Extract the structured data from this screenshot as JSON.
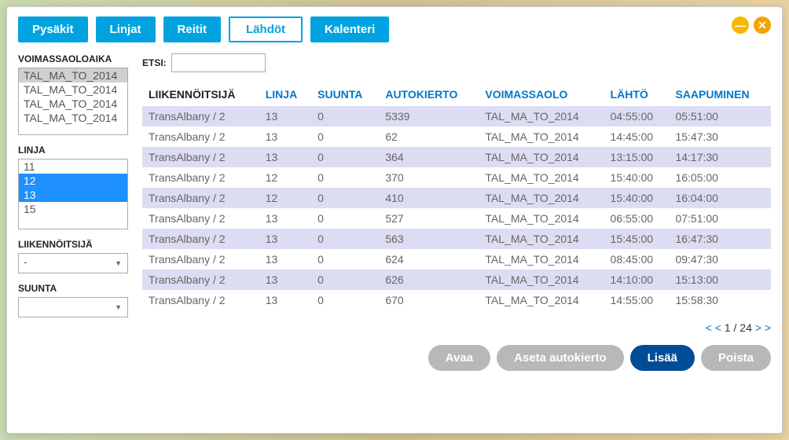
{
  "tabs": {
    "pysakit": "Pysäkit",
    "linjat": "Linjat",
    "reitit": "Reitit",
    "lahdot": "Lähdöt",
    "kalenteri": "Kalenteri"
  },
  "sidebar": {
    "voimassaoloaika_label": "VOIMASSAOLOAIKA",
    "voimassaolo_items": [
      "TAL_MA_TO_2014",
      "TAL_MA_TO_2014",
      "TAL_MA_TO_2014",
      "TAL_MA_TO_2014"
    ],
    "linja_label": "LINJA",
    "linja_items": [
      "11",
      "12",
      "13",
      "15"
    ],
    "liikennoitsija_label": "LIIKENNÖITSIJÄ",
    "liikennoitsija_value": "-",
    "suunta_label": "SUUNTA",
    "suunta_value": ""
  },
  "search": {
    "label": "ETSI:",
    "value": ""
  },
  "table": {
    "headers": {
      "liikennoitsija": "LIIKENNÖITSIJÄ",
      "linja": "LINJA",
      "suunta": "SUUNTA",
      "autokierto": "AUTOKIERTO",
      "voimassaolo": "VOIMASSAOLO",
      "lahto": "LÄHTÖ",
      "saapuminen": "SAAPUMINEN"
    },
    "rows": [
      {
        "liik": "TransAlbany / 2",
        "linja": "13",
        "suunta": "0",
        "auto": "5339",
        "voim": "TAL_MA_TO_2014",
        "lahto": "04:55:00",
        "saap": "05:51:00"
      },
      {
        "liik": "TransAlbany / 2",
        "linja": "13",
        "suunta": "0",
        "auto": "62",
        "voim": "TAL_MA_TO_2014",
        "lahto": "14:45:00",
        "saap": "15:47:30"
      },
      {
        "liik": "TransAlbany / 2",
        "linja": "13",
        "suunta": "0",
        "auto": "364",
        "voim": "TAL_MA_TO_2014",
        "lahto": "13:15:00",
        "saap": "14:17:30"
      },
      {
        "liik": "TransAlbany / 2",
        "linja": "12",
        "suunta": "0",
        "auto": "370",
        "voim": "TAL_MA_TO_2014",
        "lahto": "15:40:00",
        "saap": "16:05:00"
      },
      {
        "liik": "TransAlbany / 2",
        "linja": "12",
        "suunta": "0",
        "auto": "410",
        "voim": "TAL_MA_TO_2014",
        "lahto": "15:40:00",
        "saap": "16:04:00"
      },
      {
        "liik": "TransAlbany / 2",
        "linja": "13",
        "suunta": "0",
        "auto": "527",
        "voim": "TAL_MA_TO_2014",
        "lahto": "06:55:00",
        "saap": "07:51:00"
      },
      {
        "liik": "TransAlbany / 2",
        "linja": "13",
        "suunta": "0",
        "auto": "563",
        "voim": "TAL_MA_TO_2014",
        "lahto": "15:45:00",
        "saap": "16:47:30"
      },
      {
        "liik": "TransAlbany / 2",
        "linja": "13",
        "suunta": "0",
        "auto": "624",
        "voim": "TAL_MA_TO_2014",
        "lahto": "08:45:00",
        "saap": "09:47:30"
      },
      {
        "liik": "TransAlbany / 2",
        "linja": "13",
        "suunta": "0",
        "auto": "626",
        "voim": "TAL_MA_TO_2014",
        "lahto": "14:10:00",
        "saap": "15:13:00"
      },
      {
        "liik": "TransAlbany / 2",
        "linja": "13",
        "suunta": "0",
        "auto": "670",
        "voim": "TAL_MA_TO_2014",
        "lahto": "14:55:00",
        "saap": "15:58:30"
      }
    ]
  },
  "pager": {
    "first": "< <",
    "current": "1",
    "sep": "/",
    "total": "24",
    "last": "> >"
  },
  "footer": {
    "avaa": "Avaa",
    "aseta": "Aseta autokierto",
    "lisaa": "Lisää",
    "poista": "Poista"
  }
}
